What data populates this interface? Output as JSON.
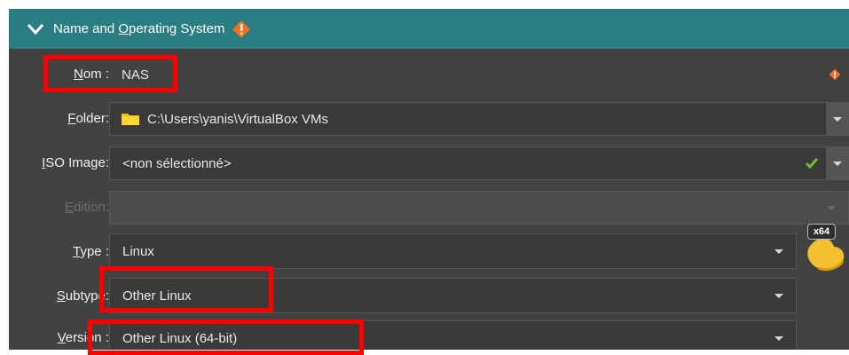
{
  "header": {
    "title_pre": "Name and ",
    "title_u": "O",
    "title_post": "perating System",
    "icons": {
      "expand": "chevron-down-icon",
      "warning": "warning-icon"
    }
  },
  "form": {
    "name": {
      "label_u": "N",
      "label_rest": "om :",
      "value": "NAS"
    },
    "folder": {
      "label_u": "F",
      "label_rest": "older:",
      "value": "C:\\Users\\yanis\\VirtualBox VMs"
    },
    "iso": {
      "label_u": "I",
      "label_rest": "SO Image:",
      "value": "<non sélectionné>"
    },
    "edition": {
      "label_u": "E",
      "label_rest": "dition:",
      "value": ""
    },
    "type": {
      "label_u": "T",
      "label_rest": "ype :",
      "value": "Linux"
    },
    "subtype": {
      "label_u": "S",
      "label_rest": "ubtype:",
      "value": "Other Linux"
    },
    "version": {
      "label_u": "V",
      "label_rest": "ersion :",
      "value": "Other Linux (64-bit)"
    }
  },
  "os_icon": {
    "badge": "x64",
    "name": "linux-penguin-icon"
  },
  "colors": {
    "header_bg": "#2a7d82",
    "panel_bg": "#424242",
    "highlight": "#ff0000",
    "warning": "#f36f21",
    "valid_check": "#6fbf2b"
  }
}
